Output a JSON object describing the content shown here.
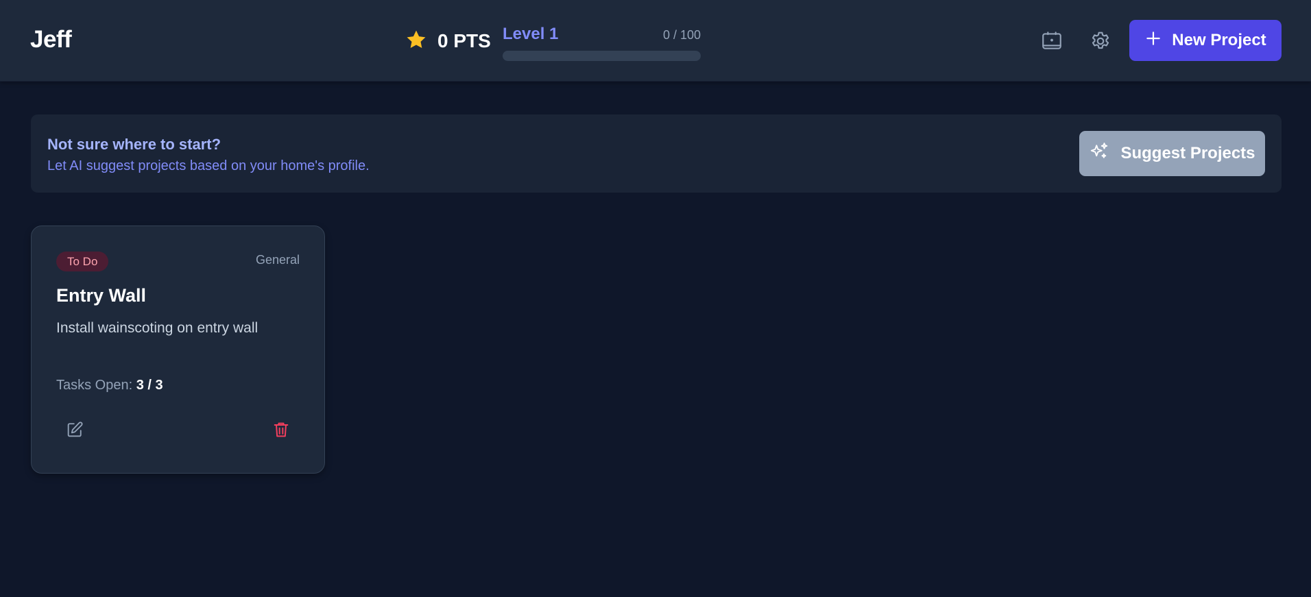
{
  "header": {
    "user_name": "Jeff",
    "points": {
      "icon": "star-icon",
      "label": "0 PTS"
    },
    "level": {
      "label": "Level 1",
      "progress_text": "0 / 100",
      "progress_fraction": 0
    },
    "actions": {
      "device_icon": "tablet-icon",
      "settings_icon": "gear-icon",
      "new_project_label": "New Project"
    }
  },
  "suggest": {
    "title": "Not sure where to start?",
    "subtitle": "Let AI suggest projects based on your home's profile.",
    "button_label": "Suggest Projects",
    "button_icon": "sparkles-icon"
  },
  "projects": [
    {
      "status": "To Do",
      "category": "General",
      "title": "Entry Wall",
      "description": "Install wainscoting on entry wall",
      "tasks_label": "Tasks Open:",
      "tasks_count": "3 / 3",
      "edit_icon": "edit-icon",
      "delete_icon": "trash-icon"
    }
  ],
  "colors": {
    "background": "#0f172a",
    "header_bg": "#1e293b",
    "accent": "#4f46e5",
    "accent_text": "#818cf8",
    "danger": "#f43f5e",
    "star": "#fbbf24"
  }
}
